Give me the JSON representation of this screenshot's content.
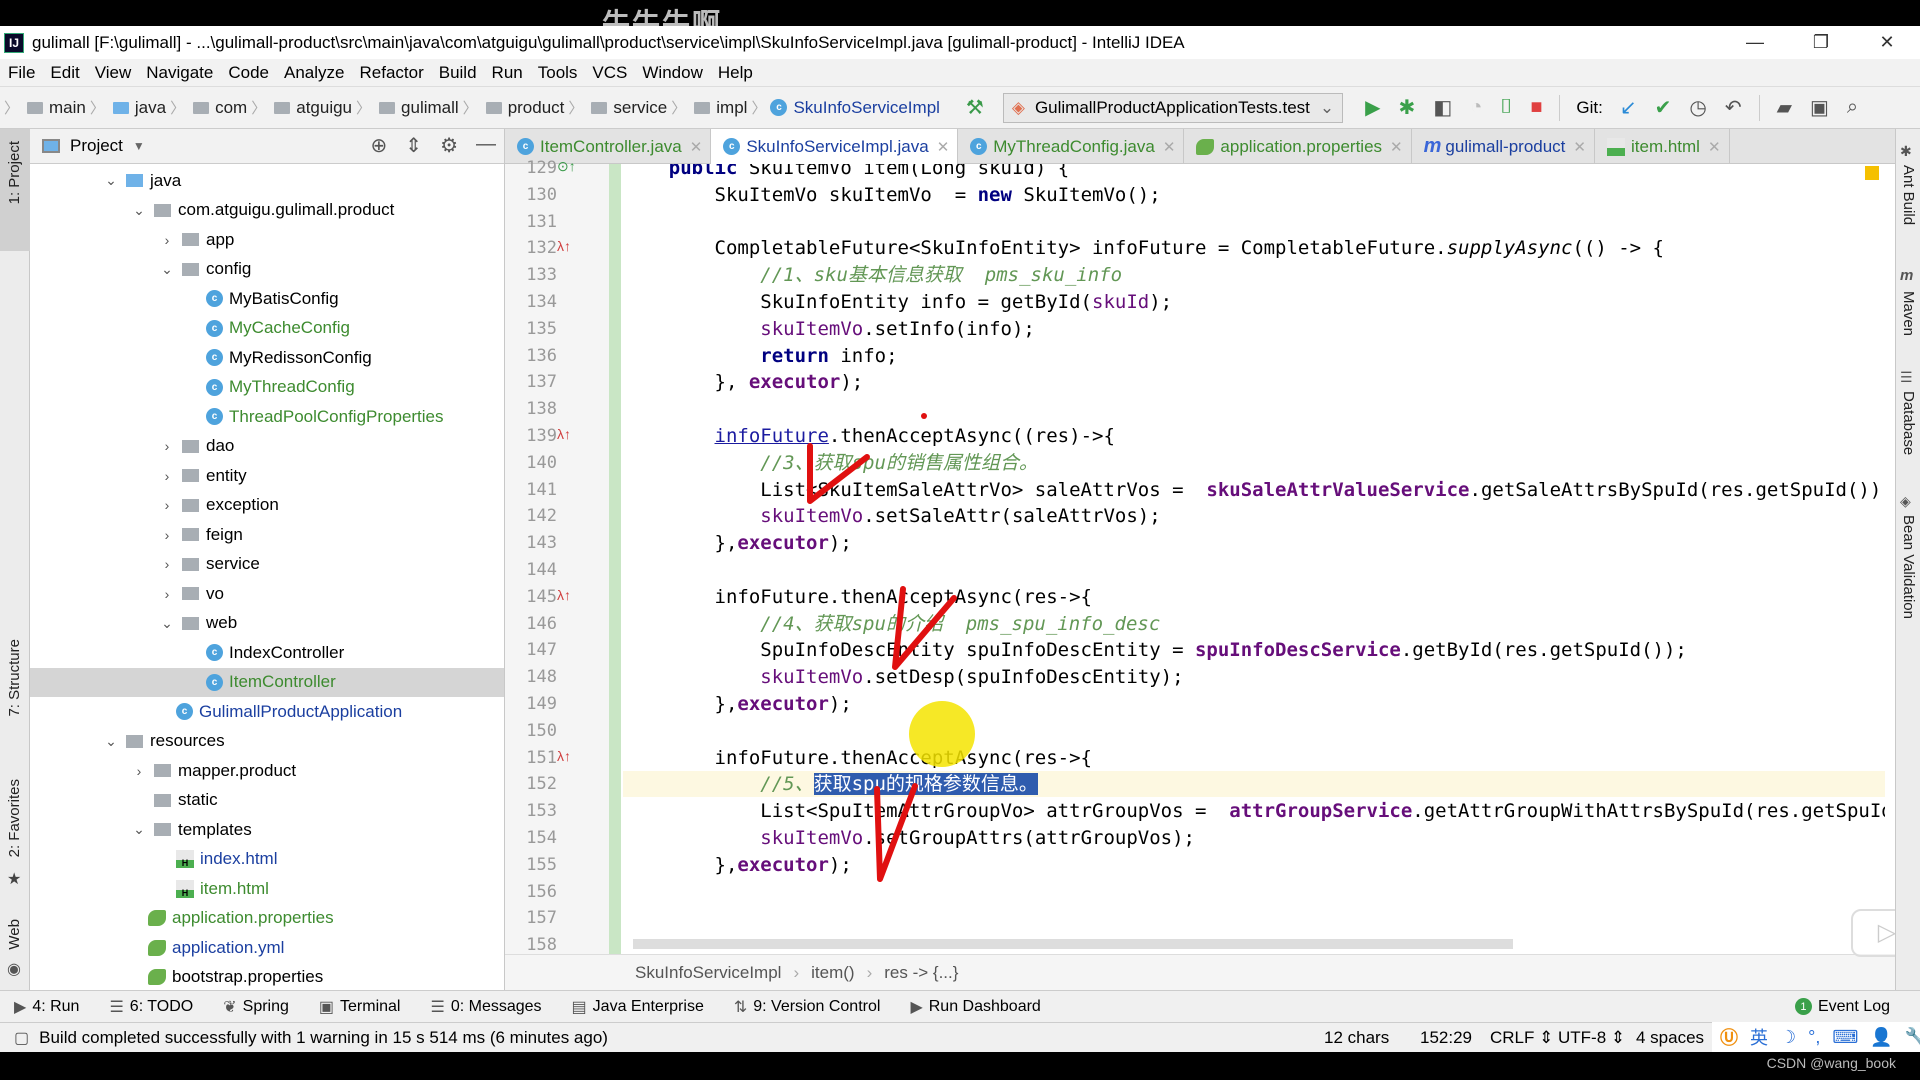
{
  "watermark_top": "牛牛牛啊",
  "window": {
    "title": "gulimall [F:\\gulimall] - ...\\gulimall-product\\src\\main\\java\\com\\atguigu\\gulimall\\product\\service\\impl\\SkuInfoServiceImpl.java [gulimall-product] - IntelliJ IDEA",
    "logo": "IJ",
    "minimize": "—",
    "restore": "❐",
    "close": "✕"
  },
  "menu": [
    "File",
    "Edit",
    "View",
    "Navigate",
    "Code",
    "Analyze",
    "Refactor",
    "Build",
    "Run",
    "Tools",
    "VCS",
    "Window",
    "Help"
  ],
  "breadcrumbs": [
    "main",
    "java",
    "com",
    "atguigu",
    "gulimall",
    "product",
    "service",
    "impl",
    "SkuInfoServiceImpl"
  ],
  "toolbar": {
    "run_config": "GulimallProductApplicationTests.test",
    "git_label": "Git:"
  },
  "left_strip": {
    "project": "1: Project",
    "structure": "7: Structure",
    "favorites": "2: Favorites",
    "web": "Web"
  },
  "right_strip": {
    "ant": "Ant Build",
    "maven": "Maven",
    "database": "Database",
    "bean": "Bean Validation"
  },
  "project_panel": {
    "title": "Project",
    "tree": [
      {
        "label": "java",
        "depth": 0,
        "arrow": "open",
        "icon": "folder-blue"
      },
      {
        "label": "com.atguigu.gulimall.product",
        "depth": 1,
        "arrow": "open",
        "icon": "package"
      },
      {
        "label": "app",
        "depth": 2,
        "arrow": "closed",
        "icon": "package"
      },
      {
        "label": "config",
        "depth": 2,
        "arrow": "open",
        "icon": "package"
      },
      {
        "label": "MyBatisConfig",
        "depth": 3,
        "icon": "class",
        "color": "default"
      },
      {
        "label": "MyCacheConfig",
        "depth": 3,
        "icon": "class",
        "color": "green"
      },
      {
        "label": "MyRedissonConfig",
        "depth": 3,
        "icon": "class",
        "color": "default"
      },
      {
        "label": "MyThreadConfig",
        "depth": 3,
        "icon": "class",
        "color": "green"
      },
      {
        "label": "ThreadPoolConfigProperties",
        "depth": 3,
        "icon": "class",
        "color": "green"
      },
      {
        "label": "dao",
        "depth": 2,
        "arrow": "closed",
        "icon": "package"
      },
      {
        "label": "entity",
        "depth": 2,
        "arrow": "closed",
        "icon": "package"
      },
      {
        "label": "exception",
        "depth": 2,
        "arrow": "closed",
        "icon": "package"
      },
      {
        "label": "feign",
        "depth": 2,
        "arrow": "closed",
        "icon": "package"
      },
      {
        "label": "service",
        "depth": 2,
        "arrow": "closed",
        "icon": "package"
      },
      {
        "label": "vo",
        "depth": 2,
        "arrow": "closed",
        "icon": "package"
      },
      {
        "label": "web",
        "depth": 2,
        "arrow": "open",
        "icon": "package"
      },
      {
        "label": "IndexController",
        "depth": 3,
        "icon": "class",
        "color": "default"
      },
      {
        "label": "ItemController",
        "depth": 3,
        "icon": "class",
        "color": "green",
        "selected": true
      },
      {
        "label": "GulimallProductApplication",
        "depth": 2,
        "icon": "class-app",
        "color": "blue"
      },
      {
        "label": "resources",
        "depth": 0,
        "arrow": "open",
        "icon": "folder-res"
      },
      {
        "label": "mapper.product",
        "depth": 1,
        "arrow": "closed",
        "icon": "package"
      },
      {
        "label": "static",
        "depth": 1,
        "icon": "package"
      },
      {
        "label": "templates",
        "depth": 1,
        "arrow": "open",
        "icon": "package"
      },
      {
        "label": "index.html",
        "depth": 2,
        "icon": "html",
        "color": "blue"
      },
      {
        "label": "item.html",
        "depth": 2,
        "icon": "html",
        "color": "green"
      },
      {
        "label": "application.properties",
        "depth": 1,
        "icon": "spring",
        "color": "green"
      },
      {
        "label": "application.yml",
        "depth": 1,
        "icon": "spring",
        "color": "blue"
      },
      {
        "label": "bootstrap.properties",
        "depth": 1,
        "icon": "spring",
        "color": "default"
      }
    ]
  },
  "tabs": [
    {
      "label": "ItemController.java",
      "icon": "class"
    },
    {
      "label": "SkuInfoServiceImpl.java",
      "icon": "class",
      "active": true
    },
    {
      "label": "MyThreadConfig.java",
      "icon": "class"
    },
    {
      "label": "application.properties",
      "icon": "spring"
    },
    {
      "label": "gulimall-product",
      "icon": "maven"
    },
    {
      "label": "item.html",
      "icon": "html"
    }
  ],
  "editor": {
    "lines": [
      {
        "n": "129",
        "mark": "impl",
        "html": "    <span class=\"kw\">public</span> SkuItemVo item(Long skuId) {"
      },
      {
        "n": "130",
        "html": "        SkuItemVo skuItemVo  = <span class=\"kw\">new</span> SkuItemVo();"
      },
      {
        "n": "131",
        "html": ""
      },
      {
        "n": "132",
        "mark": "lambda",
        "html": "        CompletableFuture&lt;SkuInfoEntity&gt; infoFuture = CompletableFuture.<span class=\"ital\">supplyAsync</span>(() -&gt; {"
      },
      {
        "n": "133",
        "html": "            <span class=\"cm\">//1、sku基本信息获取  pms_sku_info</span>"
      },
      {
        "n": "134",
        "html": "            SkuInfoEntity info = getById(<span class=\"fld\">skuId</span>);"
      },
      {
        "n": "135",
        "html": "            <span class=\"fld\">skuItemVo</span>.setInfo(info);"
      },
      {
        "n": "136",
        "html": "            <span class=\"kw\">return</span> info;"
      },
      {
        "n": "137",
        "html": "        }, <span class=\"fldb\">executor</span>);"
      },
      {
        "n": "138",
        "html": ""
      },
      {
        "n": "139",
        "mark": "lambda",
        "html": "        <span class=\"und\">infoFuture</span>.thenAcceptAsync((res)-&gt;{"
      },
      {
        "n": "140",
        "html": "            <span class=\"cm\">//3、获取spu的销售属性组合。</span>"
      },
      {
        "n": "141",
        "html": "            List&lt;SkuItemSaleAttrVo&gt; saleAttrVos =  <span class=\"fldb\">skuSaleAttrValueService</span>.getSaleAttrsBySpuId(res.getSpuId());"
      },
      {
        "n": "142",
        "html": "            <span class=\"fld\">skuItemVo</span>.setSaleAttr(saleAttrVos);"
      },
      {
        "n": "143",
        "html": "        },<span class=\"fldb\">executor</span>);"
      },
      {
        "n": "144",
        "html": ""
      },
      {
        "n": "145",
        "mark": "lambda",
        "html": "        infoFuture.thenAcceptAsync(res-&gt;{"
      },
      {
        "n": "146",
        "html": "            <span class=\"cm\">//4、获取spu的介绍  pms_spu_info_desc</span>"
      },
      {
        "n": "147",
        "html": "            SpuInfoDescEntity spuInfoDescEntity = <span class=\"fldb\">spuInfoDescService</span>.getById(res.getSpuId());"
      },
      {
        "n": "148",
        "html": "            <span class=\"fld\">skuItemVo</span>.setDesp(spuInfoDescEntity);"
      },
      {
        "n": "149",
        "html": "        },<span class=\"fldb\">executor</span>);"
      },
      {
        "n": "150",
        "html": ""
      },
      {
        "n": "151",
        "mark": "lambda",
        "html": "        infoFuture.thenAcceptAsync(res-&gt;{"
      },
      {
        "n": "152",
        "current": true,
        "html": "            <span class=\"cm\">//5、</span><span class=\"selt\">获取spu的规格参数信息。</span>"
      },
      {
        "n": "153",
        "html": "            List&lt;SpuItemAttrGroupVo&gt; attrGroupVos =  <span class=\"fldb\">attrGroupService</span>.getAttrGroupWithAttrsBySpuId(res.getSpuId());"
      },
      {
        "n": "154",
        "html": "            <span class=\"fld\">skuItemVo</span>.setGroupAttrs(attrGroupVos);"
      },
      {
        "n": "155",
        "html": "        },<span class=\"fldb\">executor</span>);"
      },
      {
        "n": "156",
        "html": ""
      },
      {
        "n": "157",
        "html": ""
      },
      {
        "n": "158",
        "html": ""
      }
    ],
    "breadcrumb": [
      "SkuInfoServiceImpl",
      "item()",
      "res -> {...}"
    ]
  },
  "bottom_tools": [
    {
      "label": "4: Run",
      "icon": "▶"
    },
    {
      "label": "6: TODO",
      "icon": "☰"
    },
    {
      "label": "Spring",
      "icon": "❦"
    },
    {
      "label": "Terminal",
      "icon": "▣"
    },
    {
      "label": "0: Messages",
      "icon": "☰"
    },
    {
      "label": "Java Enterprise",
      "icon": "▤"
    },
    {
      "label": "9: Version Control",
      "icon": "⇅"
    },
    {
      "label": "Run Dashboard",
      "icon": "▶"
    }
  ],
  "event_log": {
    "label": "Event Log",
    "count": "1"
  },
  "status": {
    "message": "Build completed successfully with 1 warning in 15 s 514 ms (6 minutes ago)",
    "chars": "12 chars",
    "position": "152:29",
    "line_sep": "CRLF",
    "encoding": "UTF-8",
    "indent": "4 spaces"
  },
  "ime": {
    "lang": "英"
  },
  "watermark_bottom": "CSDN @wang_book",
  "colors": {
    "accent": "#2f5cae",
    "annotation": "#e01010",
    "highlight": "#f5e400"
  }
}
